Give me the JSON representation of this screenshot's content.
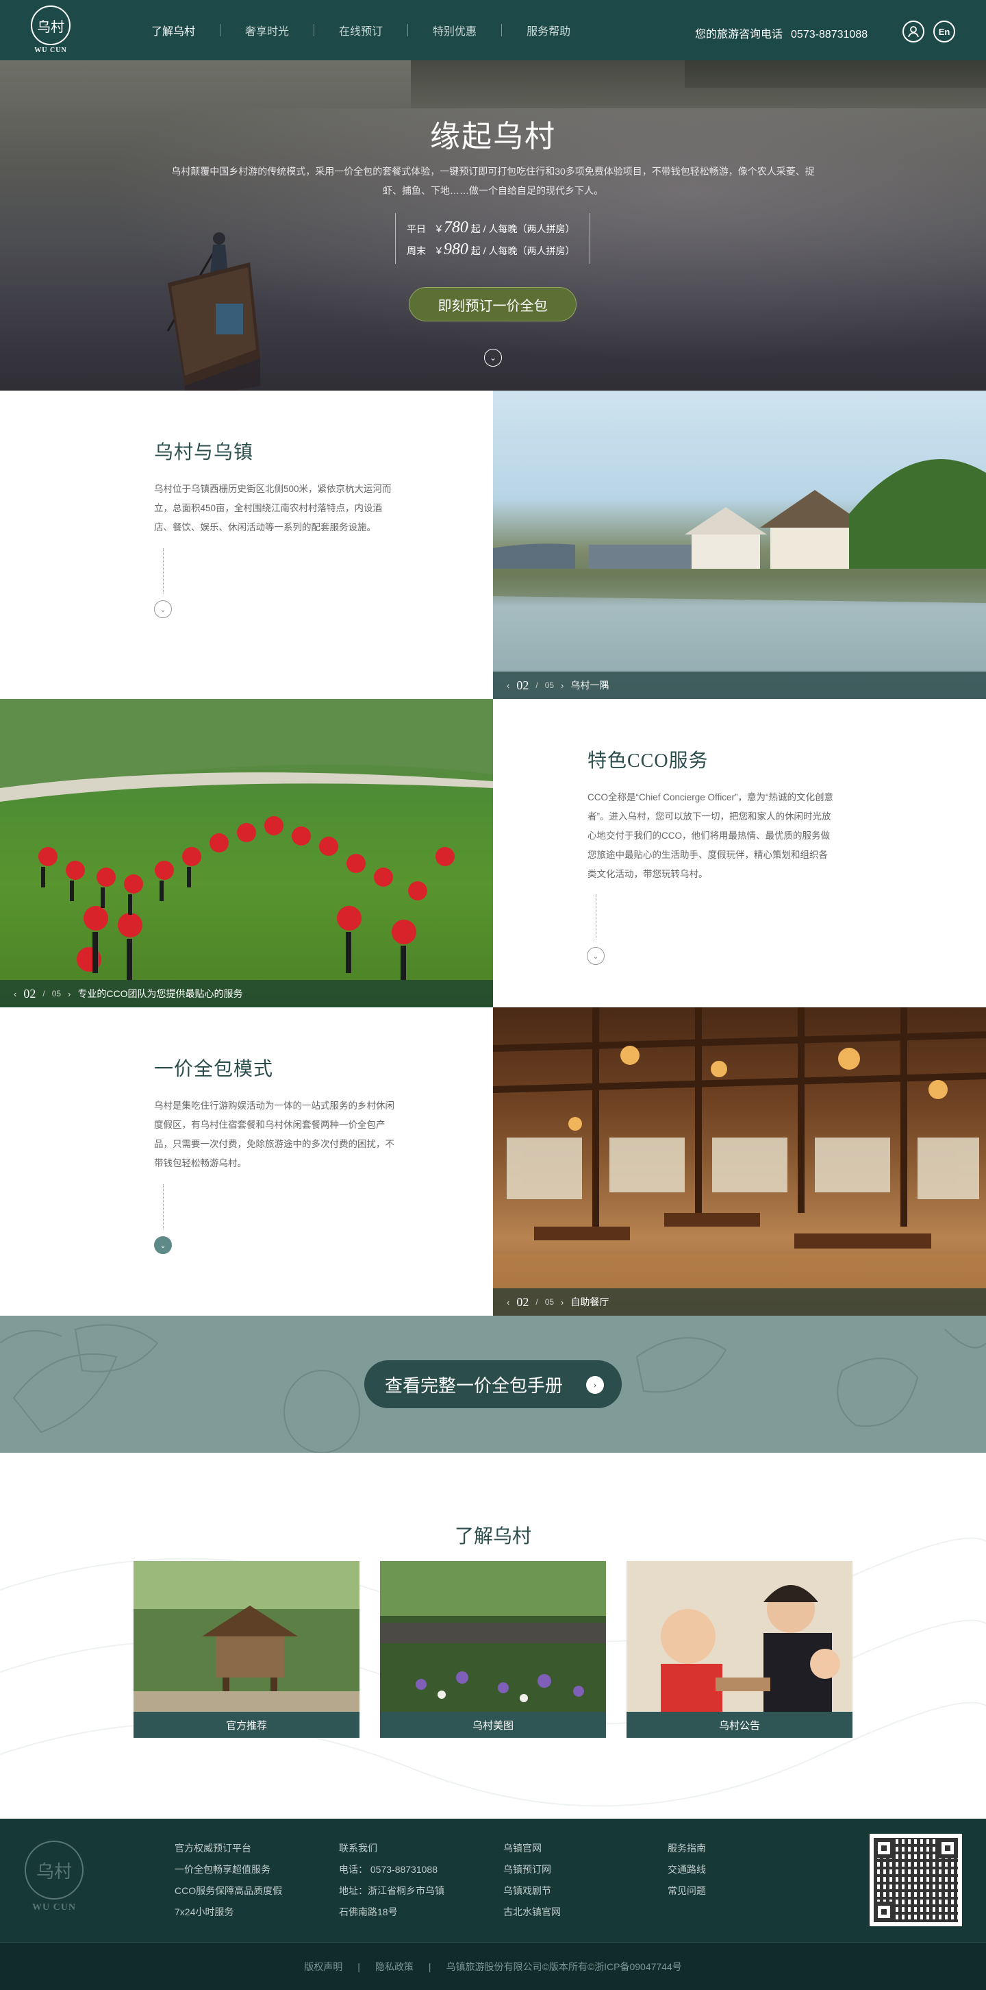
{
  "header": {
    "logo_text": "WU CUN",
    "logo_glyph": "乌村",
    "nav": [
      "了解乌村",
      "奢享时光",
      "在线预订",
      "特别优惠",
      "服务帮助"
    ],
    "hotline_label": "您的旅游咨询电话",
    "hotline_number": "0573-88731088",
    "lang_label": "En"
  },
  "hero": {
    "title": "缘起乌村",
    "desc": "乌村颠覆中国乡村游的传统模式，采用一价全包的套餐式体验，一键预订即可打包吃住行和30多项免费体验项目，不带钱包轻松畅游，像个农人采菱、捉虾、捕鱼、下地……做一个自给自足的现代乡下人。",
    "weekday_label": "平日",
    "weekday_price": "780",
    "weekend_label": "周末",
    "weekend_price": "980",
    "currency": "￥",
    "price_suffix": "起 / 人每晚（两人拼房）",
    "cta": "即刻预订一价全包"
  },
  "features": [
    {
      "title": "乌村与乌镇",
      "desc": "乌村位于乌镇西栅历史街区北侧500米，紧依京杭大运河而立，总面积450亩，全村围绕江南农村村落特点，内设酒店、餐饮、娱乐、休闲活动等一系列的配套服务设施。",
      "current": "02",
      "total": "05",
      "caption": "乌村一隅"
    },
    {
      "title": "特色CCO服务",
      "desc": "CCO全称是“Chief Concierge Officer”，意为“热诚的文化创意者”。进入乌村，您可以放下一切，把您和家人的休闲时光放心地交付于我们的CCO，他们将用最热情、最优质的服务做您旅途中最贴心的生活助手、度假玩伴，精心策划和组织各类文化活动，带您玩转乌村。",
      "current": "02",
      "total": "05",
      "caption": "专业的CCO团队为您提供最贴心的服务"
    },
    {
      "title": "一价全包模式",
      "desc": "乌村是集吃住行游购娱活动为一体的一站式服务的乡村休闲度假区，有乌村住宿套餐和乌村休闲套餐两种一价全包产品，只需要一次付费，免除旅游途中的多次付费的困扰，不带钱包轻松畅游乌村。",
      "current": "02",
      "total": "05",
      "caption": "自助餐厅"
    }
  ],
  "cta_band": {
    "label": "查看完整一价全包手册"
  },
  "know": {
    "title": "了解乌村",
    "cards": [
      "官方推荐",
      "乌村美图",
      "乌村公告"
    ]
  },
  "footer": {
    "col1": [
      "官方权威预订平台",
      "一价全包畅享超值服务",
      "CCO服务保障高品质度假",
      "7x24小时服务"
    ],
    "col2": [
      "联系我们",
      "电话： 0573-88731088",
      "地址：浙江省桐乡市乌镇",
      "石佛南路18号"
    ],
    "col3": [
      "乌镇官网",
      "乌镇预订网",
      "乌镇戏剧节",
      "古北水镇官网"
    ],
    "col4": [
      "服务指南",
      "交通路线",
      "常见问题"
    ],
    "bottom": [
      "版权声明",
      "|",
      "隐私政策",
      "|",
      "乌镇旅游股份有限公司©版本所有©浙ICP备09047744号"
    ]
  },
  "colors": {
    "brand": "#1d4a49",
    "accent_green": "#5c7035",
    "band": "#7f9c99",
    "title_text": "#2b4d4c"
  },
  "icons": [
    "user-icon",
    "chevron-down-icon",
    "arrow-right-icon",
    "chevron-left-icon",
    "chevron-right-icon"
  ]
}
